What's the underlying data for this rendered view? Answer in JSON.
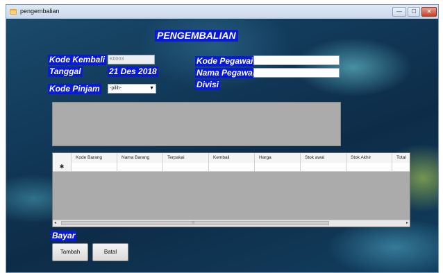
{
  "window": {
    "title": "pengembalian",
    "minimize_glyph": "—",
    "maximize_glyph": "☐",
    "close_glyph": "✕"
  },
  "form": {
    "heading": "PENGEMBALIAN",
    "kode_kembali": {
      "label": "Kode Kembali",
      "value": "K0003"
    },
    "tanggal": {
      "label": "Tanggal",
      "value": "21 Des 2018"
    },
    "kode_pinjam": {
      "label": "Kode Pinjam",
      "value": "-pilih-"
    },
    "kode_pegawai": {
      "label": "Kode Pegawai",
      "value": ""
    },
    "nama_pegawai": {
      "label": "Nama Pegawai",
      "value": ""
    },
    "divisi": {
      "label": "Divisi"
    },
    "bayar": {
      "label": "Bayar"
    }
  },
  "grid": {
    "columns": [
      "Kode Barang",
      "Nama Barang",
      "Terpakai",
      "Kembali",
      "Harga",
      "Stok awal",
      "Stok Akhir",
      "Total"
    ],
    "new_row_marker": "✱",
    "scroll_left": "◂",
    "scroll_right": "▸",
    "scroll_grip": "⦙⦙⦙"
  },
  "buttons": {
    "tambah": "Tambah",
    "batal": "Batal"
  },
  "colors": {
    "label_bg": "#0a1bd6",
    "label_text": "#ffffff",
    "panel_bg": "#ababab"
  }
}
